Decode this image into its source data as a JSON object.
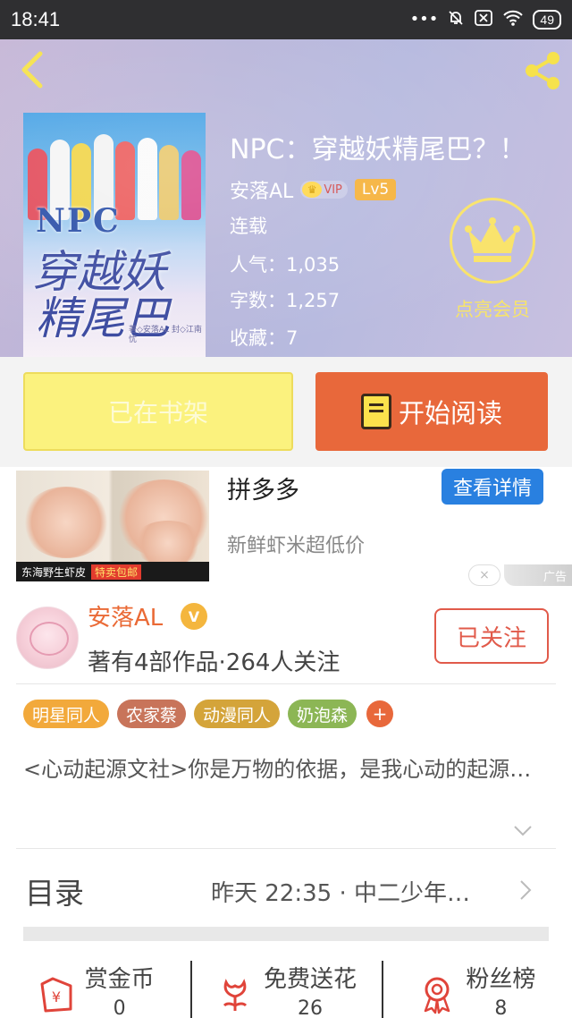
{
  "status_bar": {
    "time": "18:41",
    "icons": [
      "signal-dots-icon",
      "mute-bell-icon",
      "no-sim-icon",
      "wifi-icon"
    ],
    "battery": "49"
  },
  "header": {
    "back_icon": "chevron-left-icon",
    "share_icon": "share-icon"
  },
  "book": {
    "cover_text": {
      "npc": "NPC",
      "line1": "穿越妖",
      "line2": "精尾巴",
      "credit": "著◇安落AL 封◇江南忧"
    },
    "title": "NPC：穿越妖精尾巴？！",
    "author": "安落AL",
    "vip_label": "VIP",
    "level": "Lv5",
    "status": "连载",
    "popularity": "人气：1,035",
    "word_count": "字数：1,257",
    "favorites": "收藏：7",
    "vip_cta": "点亮会员"
  },
  "buttons": {
    "shelf": "已在书架",
    "read": "开始阅读"
  },
  "ad": {
    "title": "拼多多",
    "button": "查看详情",
    "description": "新鲜虾米超低价",
    "image_caption": "东海野生虾皮",
    "image_tag": "特卖包邮",
    "close": "×",
    "ad_tag": "广告"
  },
  "author_card": {
    "name": "安落AL",
    "verified_badge": "V",
    "stats": "著有4部作品·264人关注",
    "follow_button": "已关注",
    "tags": [
      {
        "label": "明星同人",
        "color": "#f2a93b"
      },
      {
        "label": "农家蔡",
        "color": "#c8745a"
      },
      {
        "label": "动漫同人",
        "color": "#d4a43a"
      },
      {
        "label": "奶泡森",
        "color": "#8cb655"
      }
    ],
    "add_tag": "+",
    "intro": "<心动起源文社>你是万物的依据，是我心动的起源…"
  },
  "toc": {
    "label": "目录",
    "update": "昨天 22:35 · 中二少年…"
  },
  "actions": [
    {
      "label": "赏金币",
      "count": "0",
      "icon": "red-envelope-icon"
    },
    {
      "label": "免费送花",
      "count": "26",
      "icon": "flower-icon"
    },
    {
      "label": "粉丝榜",
      "count": "8",
      "icon": "medal-icon"
    }
  ],
  "colors": {
    "accent_orange": "#e8683b",
    "shelf_yellow": "#fbf27e",
    "ad_blue": "#2980e0",
    "follow_red": "#e15a4a"
  }
}
